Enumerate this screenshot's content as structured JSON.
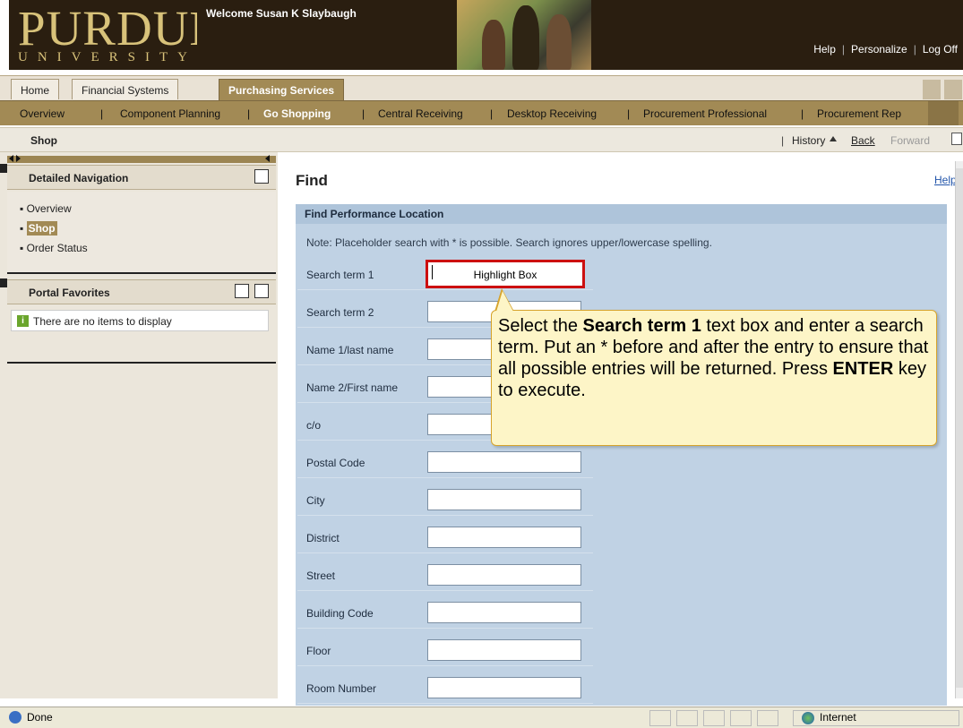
{
  "header": {
    "logo_main": "PURDUE",
    "logo_sub": "UNIVERSITY",
    "welcome": "Welcome Susan K Slaybaugh",
    "links": [
      "Help",
      "Personalize",
      "Log Off"
    ]
  },
  "top_tabs": [
    "Home",
    "Financial Systems",
    "Purchasing Services"
  ],
  "sub_tabs": [
    "Overview",
    "Component Planning",
    "Go Shopping",
    "Central Receiving",
    "Desktop Receiving",
    "Procurement Professional",
    "Procurement Rep"
  ],
  "shop_bar": {
    "title": "Shop",
    "history": "History",
    "back": "Back",
    "forward": "Forward"
  },
  "left_nav": {
    "detailed_title": "Detailed Navigation",
    "items": [
      "Overview",
      "Shop",
      "Order Status"
    ],
    "favorites_title": "Portal Favorites",
    "favorites_empty": "There are no items to display"
  },
  "main": {
    "title": "Find",
    "help": "Help",
    "section_title": "Find Performance Location",
    "note": "Note: Placeholder search with * is possible. Search ignores upper/lowercase spelling.",
    "fields": [
      "Search term 1",
      "Search term 2",
      "Name 1/last name",
      "Name 2/First name",
      "c/o",
      "Postal Code",
      "City",
      "District",
      "Street",
      "Building Code",
      "Floor",
      "Room Number"
    ],
    "highlight_label": "Highlight Box"
  },
  "callout": {
    "p1": "Select the ",
    "b1": "Search term 1",
    "p2": " text box and enter a search term.  Put an * before and after the entry to ensure that all possible entries will be returned. Press ",
    "b2": "ENTER",
    "p3": " key to execute."
  },
  "status_bar": {
    "left": "Done",
    "zone": "Internet"
  },
  "colors": {
    "header_dark": "#2a1e10",
    "gold": "#d8c27a",
    "tab_gold": "#a28a55",
    "form_blue": "#c0d2e4",
    "highlight_red": "#cc1010",
    "callout_yellow": "#fdf5c7"
  }
}
